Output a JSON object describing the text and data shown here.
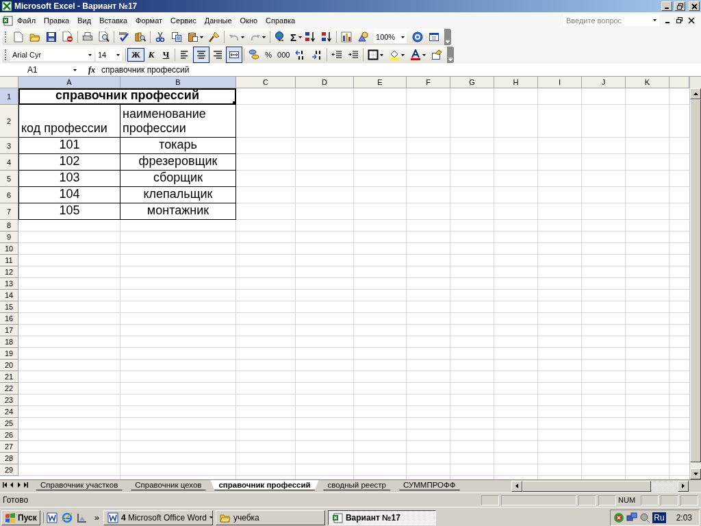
{
  "window": {
    "title": "Microsoft Excel - Вариант №17"
  },
  "menu": {
    "items": [
      "Файл",
      "Правка",
      "Вид",
      "Вставка",
      "Формат",
      "Сервис",
      "Данные",
      "Окно",
      "Справка"
    ],
    "question": {
      "placeholder": "Введите вопрос"
    }
  },
  "standard_toolbar": {
    "sum_label": "Σ",
    "zoom": "100%"
  },
  "formatting_toolbar": {
    "font": "Arial Cyr",
    "size": "14",
    "styles": [
      {
        "label": "Ж",
        "kind": "bold",
        "selected": true
      },
      {
        "label": "К",
        "kind": "italic",
        "selected": false
      },
      {
        "label": "Ч",
        "kind": "underline",
        "selected": false
      }
    ],
    "alignment": [
      {
        "kind": "left",
        "selected": false
      },
      {
        "kind": "center",
        "selected": true
      },
      {
        "kind": "right",
        "selected": false
      },
      {
        "kind": "merge",
        "selected": true
      }
    ],
    "percent": "%",
    "thousands": "000"
  },
  "formula_bar": {
    "name_box": "A1",
    "fx": "fx",
    "content": "справочник профессий"
  },
  "sheet": {
    "columns": [
      {
        "label": "A",
        "selected": true
      },
      {
        "label": "B",
        "selected": true
      },
      {
        "label": "C",
        "selected": false
      },
      {
        "label": "D",
        "selected": false
      },
      {
        "label": "E",
        "selected": false
      },
      {
        "label": "F",
        "selected": false
      },
      {
        "label": "G",
        "selected": false
      },
      {
        "label": "H",
        "selected": false
      },
      {
        "label": "I",
        "selected": false
      },
      {
        "label": "J",
        "selected": false
      },
      {
        "label": "K",
        "selected": false
      }
    ],
    "rows": [
      {
        "label": "1",
        "selected": true,
        "cells": [
          {
            "text": "справочник профессий",
            "merged": true,
            "selected": true,
            "bold": true,
            "centered": true,
            "bordered": true
          }
        ]
      },
      {
        "label": "2",
        "selected": false,
        "cells": [
          {
            "text": "код профессии",
            "centered": false,
            "bordered": true
          },
          {
            "text": "наименование профессии",
            "centered": false,
            "bordered": true
          }
        ]
      },
      {
        "label": "3",
        "selected": false,
        "cells": [
          {
            "text": "101",
            "centered": true,
            "bordered": true
          },
          {
            "text": "токарь",
            "centered": true,
            "bordered": true
          }
        ]
      },
      {
        "label": "4",
        "selected": false,
        "cells": [
          {
            "text": "102",
            "centered": true,
            "bordered": true
          },
          {
            "text": "фрезеровщик",
            "centered": true,
            "bordered": true
          }
        ]
      },
      {
        "label": "5",
        "selected": false,
        "cells": [
          {
            "text": "103",
            "centered": true,
            "bordered": true
          },
          {
            "text": "сборщик",
            "centered": true,
            "bordered": true
          }
        ]
      },
      {
        "label": "6",
        "selected": false,
        "cells": [
          {
            "text": "104",
            "centered": true,
            "bordered": true
          },
          {
            "text": "клепальщик",
            "centered": true,
            "bordered": true
          }
        ]
      },
      {
        "label": "7",
        "selected": false,
        "cells": [
          {
            "text": "105",
            "centered": true,
            "bordered": true
          },
          {
            "text": "монтажник",
            "centered": true,
            "bordered": true
          }
        ]
      },
      {
        "label": "8",
        "selected": false
      },
      {
        "label": "9",
        "selected": false
      },
      {
        "label": "10",
        "selected": false
      },
      {
        "label": "11",
        "selected": false
      },
      {
        "label": "12",
        "selected": false
      },
      {
        "label": "13",
        "selected": false
      },
      {
        "label": "14",
        "selected": false
      },
      {
        "label": "15",
        "selected": false
      },
      {
        "label": "16",
        "selected": false
      },
      {
        "label": "17",
        "selected": false
      },
      {
        "label": "18",
        "selected": false
      },
      {
        "label": "19",
        "selected": false
      },
      {
        "label": "20",
        "selected": false
      },
      {
        "label": "21",
        "selected": false
      },
      {
        "label": "22",
        "selected": false
      },
      {
        "label": "23",
        "selected": false
      },
      {
        "label": "24",
        "selected": false
      },
      {
        "label": "25",
        "selected": false
      },
      {
        "label": "26",
        "selected": false
      },
      {
        "label": "27",
        "selected": false
      },
      {
        "label": "28",
        "selected": false
      },
      {
        "label": "29",
        "selected": false
      }
    ]
  },
  "sheet_tabs": [
    {
      "label": "Справочник участков",
      "selected": false
    },
    {
      "label": "Справочник цехов",
      "selected": false
    },
    {
      "label": "справочник профессий",
      "selected": true
    },
    {
      "label": "сводный реестр",
      "selected": false
    },
    {
      "label": "СУММПРОФФ",
      "selected": false
    }
  ],
  "status_bar": {
    "status": "Готово",
    "num": "NUM"
  },
  "taskbar": {
    "start": "Пуск",
    "more": "»",
    "tasks": [
      {
        "label": "**4** Microsoft Office Word",
        "kind": "word",
        "selected": false
      },
      {
        "label": "учебка",
        "kind": "folder",
        "selected": false
      },
      {
        "label": "Вариант №17",
        "kind": "excel",
        "selected": true
      }
    ],
    "language": "Ru",
    "clock": "2:03"
  }
}
